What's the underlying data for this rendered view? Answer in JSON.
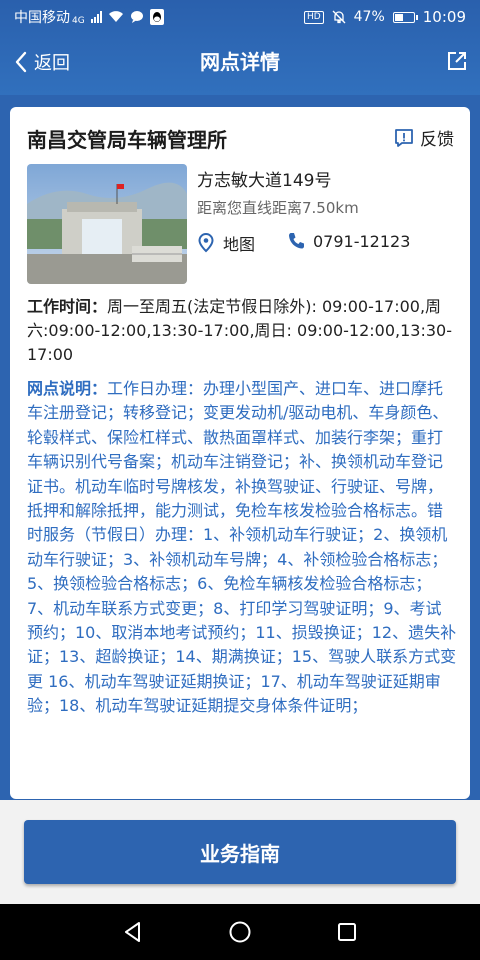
{
  "status": {
    "carrier": "中国移动",
    "network": "4G",
    "battery": "47%",
    "battery_level": 0.47,
    "time": "10:09"
  },
  "nav": {
    "back_label": "返回",
    "title": "网点详情"
  },
  "office": {
    "name": "南昌交管局车辆管理所",
    "feedback_label": "反馈",
    "address": "方志敏大道149号",
    "distance": "距离您直线距离7.50km",
    "map_label": "地图",
    "phone": "0791-12123"
  },
  "hours": {
    "label": "工作时间：",
    "text": "周一至周五(法定节假日除外): 09:00-17:00,周六:09:00-12:00,13:30-17:00,周日: 09:00-12:00,13:30-17:00"
  },
  "description": {
    "label": "网点说明：",
    "text": "工作日办理：办理小型国产、进口车、进口摩托车注册登记；转移登记；变更发动机/驱动电机、车身颜色、轮毂样式、保险杠样式、散热面罩样式、加装行李架；重打车辆识别代号备案；机动车注销登记；补、换领机动车登记证书。机动车临时号牌核发，补换驾驶证、行驶证、号牌，抵押和解除抵押，能力测试，免检车核发检验合格标志。错时服务（节假日）办理：1、补领机动车行驶证；2、换领机动车行驶证；3、补领机动车号牌；4、补领检验合格标志；5、换领检验合格标志；6、免检车辆核发检验合格标志；7、机动车联系方式变更；8、打印学习驾驶证明；9、考试预约；10、取消本地考试预约；11、损毁换证；12、遗失补证；13、超龄换证；14、期满换证；15、驾驶人联系方式变更 16、机动车驾驶证延期换证；17、机动车驾驶证延期审验；18、机动车驾驶证延期提交身体条件证明；"
  },
  "actions": {
    "guide_label": "业务指南"
  },
  "colors": {
    "brand": "#2d64b0",
    "link": "#2f6dc0"
  }
}
